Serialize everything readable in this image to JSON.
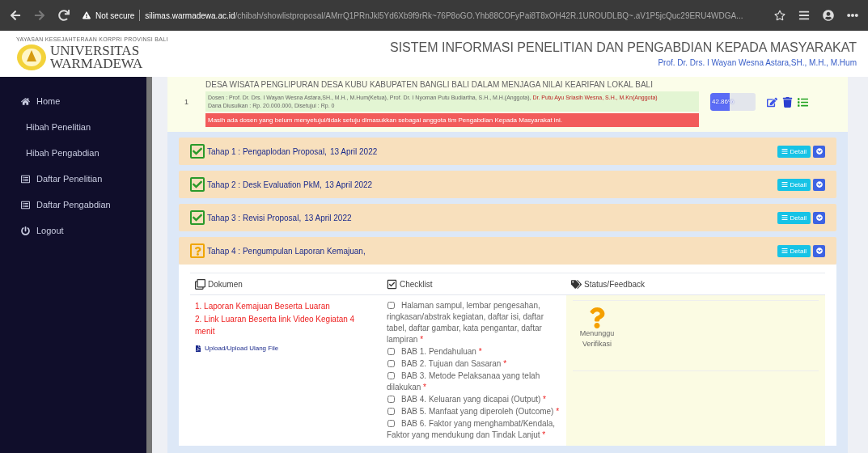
{
  "browser": {
    "security": "Not secure",
    "url_host": "silimas.warmadewa.ac.id",
    "url_path": "/chibah/showlistproposal/AMrrQ1PRnJkl5Yd6Xb9f9rRk~76P8oGO.Yhb88COFyPai8T8xOH42R.1UROUDLBQ~.aV1P5jcQuc29ERU4WDGA..."
  },
  "header": {
    "logo_tagline": "YAYASAN KESEJAHTERAAN KORPRI PROVINSI BALI",
    "logo_name": [
      "UNIVERSITAS",
      "WARMADEWA"
    ],
    "title": "SISTEM INFORMASI PENELITIAN DAN PENGABDIAN KEPADA MASYARAKAT",
    "user": "Prof. Dr. Drs. I Wayan Wesna Astara,SH., M.H., M.Hum"
  },
  "sidebar": {
    "items": [
      {
        "label": "Home",
        "kind": "home"
      },
      {
        "label": "Hibah Penelitian",
        "kind": "plain"
      },
      {
        "label": "Hibah Pengabdian",
        "kind": "plain"
      },
      {
        "label": "Daftar Penelitian",
        "kind": "list"
      },
      {
        "label": "Daftar Pengabdian",
        "kind": "list"
      },
      {
        "label": "Logout",
        "kind": "logout"
      }
    ]
  },
  "proposal": {
    "number": "1",
    "title": "DESA WISATA PENGLIPURAN DESA KUBU KABUPATEN BANGLI BALI DALAM MENJAGA NILAI KEARIFAN LOKAL BALI",
    "members": [
      {
        "text": "Dosen : Prof. Dr. Drs. I Wayan Wesna Astara,SH., M.H., M.Hum(Ketua), Prof. Dr. I Nyoman Putu Budiartha, S.H., M.H.(Anggota), ",
        "pending": false
      },
      {
        "text": "Dr. Putu Ayu Sriasih Wesna, S.H., M.Kn(Anggota)",
        "pending": true
      }
    ],
    "funds": "Dana Diusulkan : Rp. 20.000.000, Disetujui : Rp. 0",
    "alert": "Masih ada dosen yang belum menyetujui/tidak setuju dimasukkan sebagai anggota tim Pengabdian Kepada Masyarakat ini.",
    "progress": {
      "level": 0.4286,
      "label": "42.86%"
    }
  },
  "stages": [
    {
      "title": "Tahap 1 : Pengaplodan Proposal,",
      "date": "13 April 2022",
      "kind": "done",
      "detail": "Detail"
    },
    {
      "title": "Tahap 2 : Desk Evaluation PkM,",
      "date": "13 April 2022",
      "kind": "done",
      "detail": "Detail"
    },
    {
      "title": "Tahap 3 : Revisi Proposal,",
      "date": "13 April 2022",
      "kind": "done",
      "detail": "Detail"
    },
    {
      "title": "Tahap 4 : Pengumpulan Laporan Kemajuan,",
      "kind": "pending",
      "detail": "Detail"
    }
  ],
  "stage_detail": {
    "columns": [
      "Dokumen",
      "Checklist",
      "Status/Feedback"
    ],
    "documents": [
      "1. Laporan Kemajuan Beserta Luaran",
      "2. Link Luaran Beserta link Video Kegiatan 4 menit"
    ],
    "upload_link": "Upload/Upload Ulang File",
    "checklist": [
      {
        "label": "Halaman sampul, lembar pengesahan, ringkasan/abstrak kegiatan, daftar isi, daftar tabel, daftar gambar, kata pengantar, daftar lampiran",
        "checked": false,
        "required": "*"
      },
      {
        "label": "BAB 1. Pendahuluan",
        "checked": false,
        "required": "*"
      },
      {
        "label": "BAB 2. Tujuan dan Sasaran",
        "checked": false,
        "required": "*"
      },
      {
        "label": "BAB 3. Metode Pelaksanaa yang telah dilakukan",
        "checked": false,
        "required": "*"
      },
      {
        "label": "BAB 4. Keluaran yang dicapai (Output)",
        "checked": false,
        "required": "*"
      },
      {
        "label": "BAB 5. Manfaat yang diperoleh (Outcome)",
        "checked": false,
        "required": "*"
      },
      {
        "label": "BAB 6. Faktor yang menghambat/Kendala, Faktor yang mendukung dan Tindak Lanjut",
        "checked": false,
        "required": "*"
      }
    ],
    "status": {
      "kind": "waiting",
      "text": "Menunggu Verifikasi"
    }
  }
}
